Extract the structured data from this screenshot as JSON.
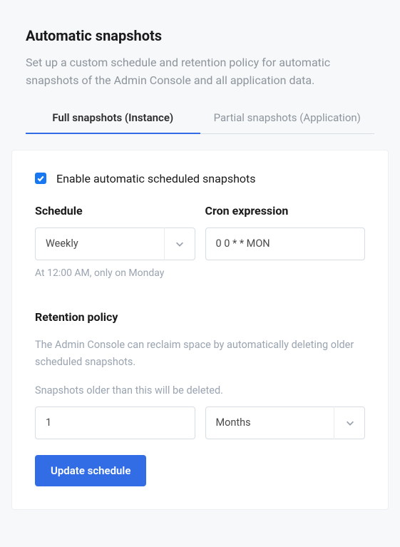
{
  "header": {
    "title": "Automatic snapshots",
    "description": "Set up a custom schedule and retention policy for automatic snapshots of the Admin Console and all application data."
  },
  "tabs": {
    "full": "Full snapshots (Instance)",
    "partial": "Partial snapshots (Application)"
  },
  "form": {
    "enable_label": "Enable automatic scheduled snapshots",
    "schedule": {
      "label": "Schedule",
      "value": "Weekly",
      "hint": "At 12:00 AM, only on Monday"
    },
    "cron": {
      "label": "Cron expression",
      "value": "0 0 * * MON"
    },
    "retention": {
      "title": "Retention policy",
      "description": "The Admin Console can reclaim space by automatically deleting older scheduled snapshots.",
      "sub": "Snapshots older than this will be deleted.",
      "value": "1",
      "unit": "Months"
    },
    "submit": "Update schedule"
  }
}
